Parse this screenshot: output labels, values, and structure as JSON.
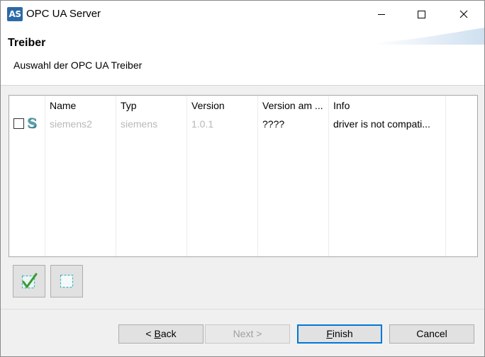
{
  "window": {
    "app_icon_text": "AS",
    "title": "OPC UA Server"
  },
  "header": {
    "title": "Treiber",
    "subtitle": "Auswahl der OPC UA Treiber"
  },
  "table": {
    "columns": [
      "Name",
      "Typ",
      "Version",
      "Version am ...",
      "Info"
    ],
    "rows": [
      {
        "checked": false,
        "icon": "siemens-s-icon",
        "name": "siemens2",
        "type": "siemens",
        "version": "1.0.1",
        "version_target": "????",
        "info": "driver is not compati..."
      }
    ]
  },
  "toolbar": {
    "select_all_icon": "check-all-icon",
    "deselect_all_icon": "uncheck-all-icon"
  },
  "buttons": {
    "back_prefix": "< ",
    "back_mnemonic": "B",
    "back_rest": "ack",
    "next_label": "Next >",
    "finish_mnemonic": "F",
    "finish_rest": "inish",
    "cancel_label": "Cancel"
  },
  "colors": {
    "accent": "#0078d7",
    "disabled_text": "#a0a0a0",
    "dim_cell_text": "#b8b8b8"
  }
}
